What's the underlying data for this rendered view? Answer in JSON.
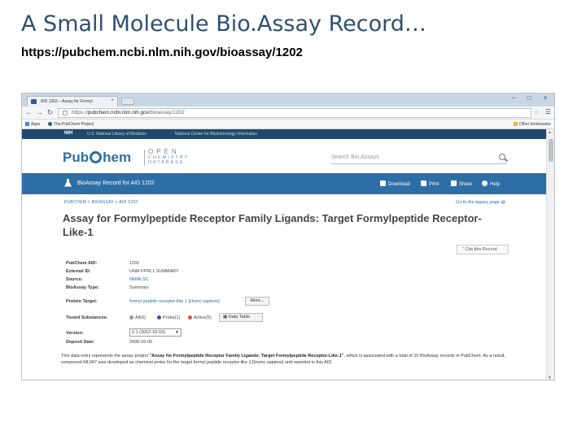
{
  "slide": {
    "title": "A Small Molecule Bio.Assay Record…",
    "url": "https://pubchem.ncbi.nlm.nih.gov/bioassay/1202"
  },
  "browser": {
    "tab_title": "AID 1202 – Assay for Formyl",
    "tab_close": "×",
    "url_prefix": "https://",
    "url_host": "pubchem.ncbi.nlm.nih.gov",
    "url_path": "/bioassay/1202",
    "bookmarks": [
      "Apps",
      "The PubChem Project"
    ],
    "other_bookmarks": "Other bookmarks",
    "window_controls": [
      "–",
      "□",
      "×"
    ]
  },
  "ncbi": {
    "nih": "NIH",
    "nlm": "U.S. National Library of Medicine",
    "ncbi": "National Center for Biotechnology Information"
  },
  "header": {
    "logo_left": "Pub",
    "logo_right": "hem",
    "open_line1": "OPEN",
    "open_line2": "CHEMISTRY",
    "open_line3": "DATABASE",
    "search_placeholder": "Search Bio.Assays"
  },
  "record_bar": {
    "title": "BioAssay Record for AID 1202",
    "actions": [
      "Download",
      "Print",
      "Share",
      "Help"
    ]
  },
  "breadcrumb": "PUBCHEM  >  BIOASSAY  >  AID 1202",
  "legacy_link": "Go to the legacy page",
  "assay_title": "Assay for Formylpeptide Receptor Family Ligands: Target Formylpeptide Receptor-Like-1",
  "cite_button": "Cite this Record",
  "info": {
    "pubchem_aid_label": "PubChem AID:",
    "pubchem_aid": "1202",
    "external_id_label": "External ID:",
    "external_id": "UNM FPRL1 SUMMARY",
    "source_label": "Source:",
    "source": "NMMLSC",
    "type_label": "BioAssay Type:",
    "type": "Summary",
    "target_label": "Protein Target:",
    "target": "formyl peptide receptor-like 1 [Homo sapiens]",
    "more_button": "More...",
    "tested_label": "Tested Substances:",
    "tested_all": "All(6)",
    "tested_probe": "Probe(1)",
    "tested_active": "Active(5)",
    "data_table": "Data Table",
    "version_label": "Version:",
    "version": "2.1 (2012-10-10)",
    "deposit_label": "Deposit Date:",
    "deposit": "2008-03-06"
  },
  "description": {
    "part1": "This data entry represents the assay project ",
    "bold": "\"Assay for Formylpeptide Receptor Family Ligands: Target Formylpeptide Receptor-Like-1\"",
    "part2": ", which is associated with a total of 10 BioAssay records in PubChem. As a result, compound ML047 was developed as chemical probe for the target formyl peptide receptor-like 1 [Homo sapiens] and reported in this AID."
  },
  "colors": {
    "ncbi_bar": "#20496f",
    "record_bar": "#2e6ea6",
    "link": "#2e6ea6",
    "probe": "#6a3fa0",
    "active": "#d9534f"
  }
}
